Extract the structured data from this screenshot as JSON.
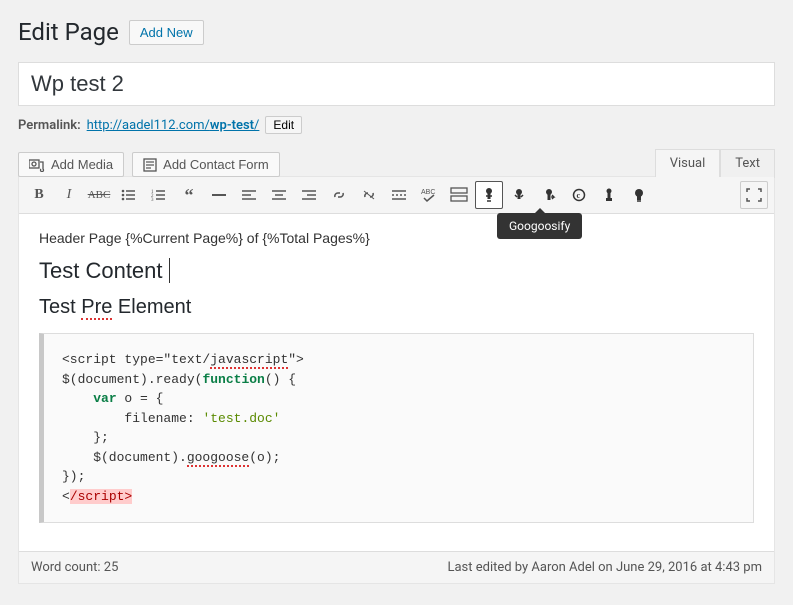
{
  "header": {
    "title": "Edit Page",
    "add_new": "Add New"
  },
  "post": {
    "title": "Wp test 2",
    "permalink_label": "Permalink:",
    "permalink_base": "http://aadel112.com/",
    "permalink_slug": "wp-test",
    "permalink_trail": "/",
    "edit_btn": "Edit"
  },
  "media": {
    "add_media": "Add Media",
    "add_contact_form": "Add Contact Form"
  },
  "tabs": {
    "visual": "Visual",
    "text": "Text"
  },
  "toolbar": {
    "tooltip": "Googoosify"
  },
  "content": {
    "header_line": "Header Page {%Current Page%} of {%Total Pages%}",
    "h1": "Test Content",
    "h2_before": "Test ",
    "h2_err": "Pre",
    "h2_after": " Element",
    "code": {
      "l1a": "<script type=\"text/",
      "l1b": "javascript",
      "l1c": "\">",
      "l2a": "$(document).ready(",
      "l2b": "function",
      "l2c": "() {",
      "l3a": "    ",
      "l3b": "var",
      "l3c": " o = {",
      "l4a": "        filename: ",
      "l4b": "'test.doc'",
      "l5": "    };",
      "l6a": "    $(document).",
      "l6b": "googoose",
      "l6c": "(o);",
      "l7": "});",
      "l8a": "<",
      "l8b": "/script>"
    }
  },
  "footer": {
    "word_count": "Word count: 25",
    "last_edited": "Last edited by Aaron Adel on June 29, 2016 at 4:43 pm"
  }
}
